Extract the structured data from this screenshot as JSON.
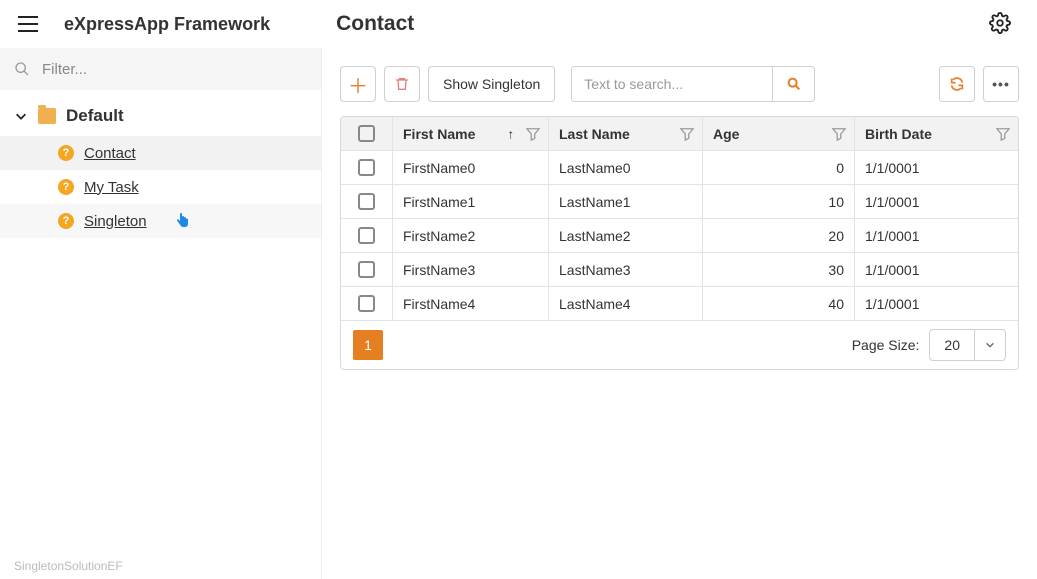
{
  "header": {
    "app_title": "eXpressApp Framework",
    "view_title": "Contact"
  },
  "sidebar": {
    "filter_placeholder": "Filter...",
    "group_label": "Default",
    "items": [
      {
        "label": "Contact"
      },
      {
        "label": "My Task"
      },
      {
        "label": "Singleton"
      }
    ],
    "footer_note": "SingletonSolutionEF"
  },
  "toolbar": {
    "show_singleton_label": "Show Singleton",
    "search_placeholder": "Text to search..."
  },
  "table": {
    "columns": {
      "first_name": "First Name",
      "last_name": "Last Name",
      "age": "Age",
      "birth_date": "Birth Date"
    },
    "rows": [
      {
        "first_name": "FirstName0",
        "last_name": "LastName0",
        "age": "0",
        "birth_date": "1/1/0001"
      },
      {
        "first_name": "FirstName1",
        "last_name": "LastName1",
        "age": "10",
        "birth_date": "1/1/0001"
      },
      {
        "first_name": "FirstName2",
        "last_name": "LastName2",
        "age": "20",
        "birth_date": "1/1/0001"
      },
      {
        "first_name": "FirstName3",
        "last_name": "LastName3",
        "age": "30",
        "birth_date": "1/1/0001"
      },
      {
        "first_name": "FirstName4",
        "last_name": "LastName4",
        "age": "40",
        "birth_date": "1/1/0001"
      }
    ],
    "pager": {
      "current_page": "1",
      "page_size_label": "Page Size:",
      "page_size_value": "20"
    }
  }
}
